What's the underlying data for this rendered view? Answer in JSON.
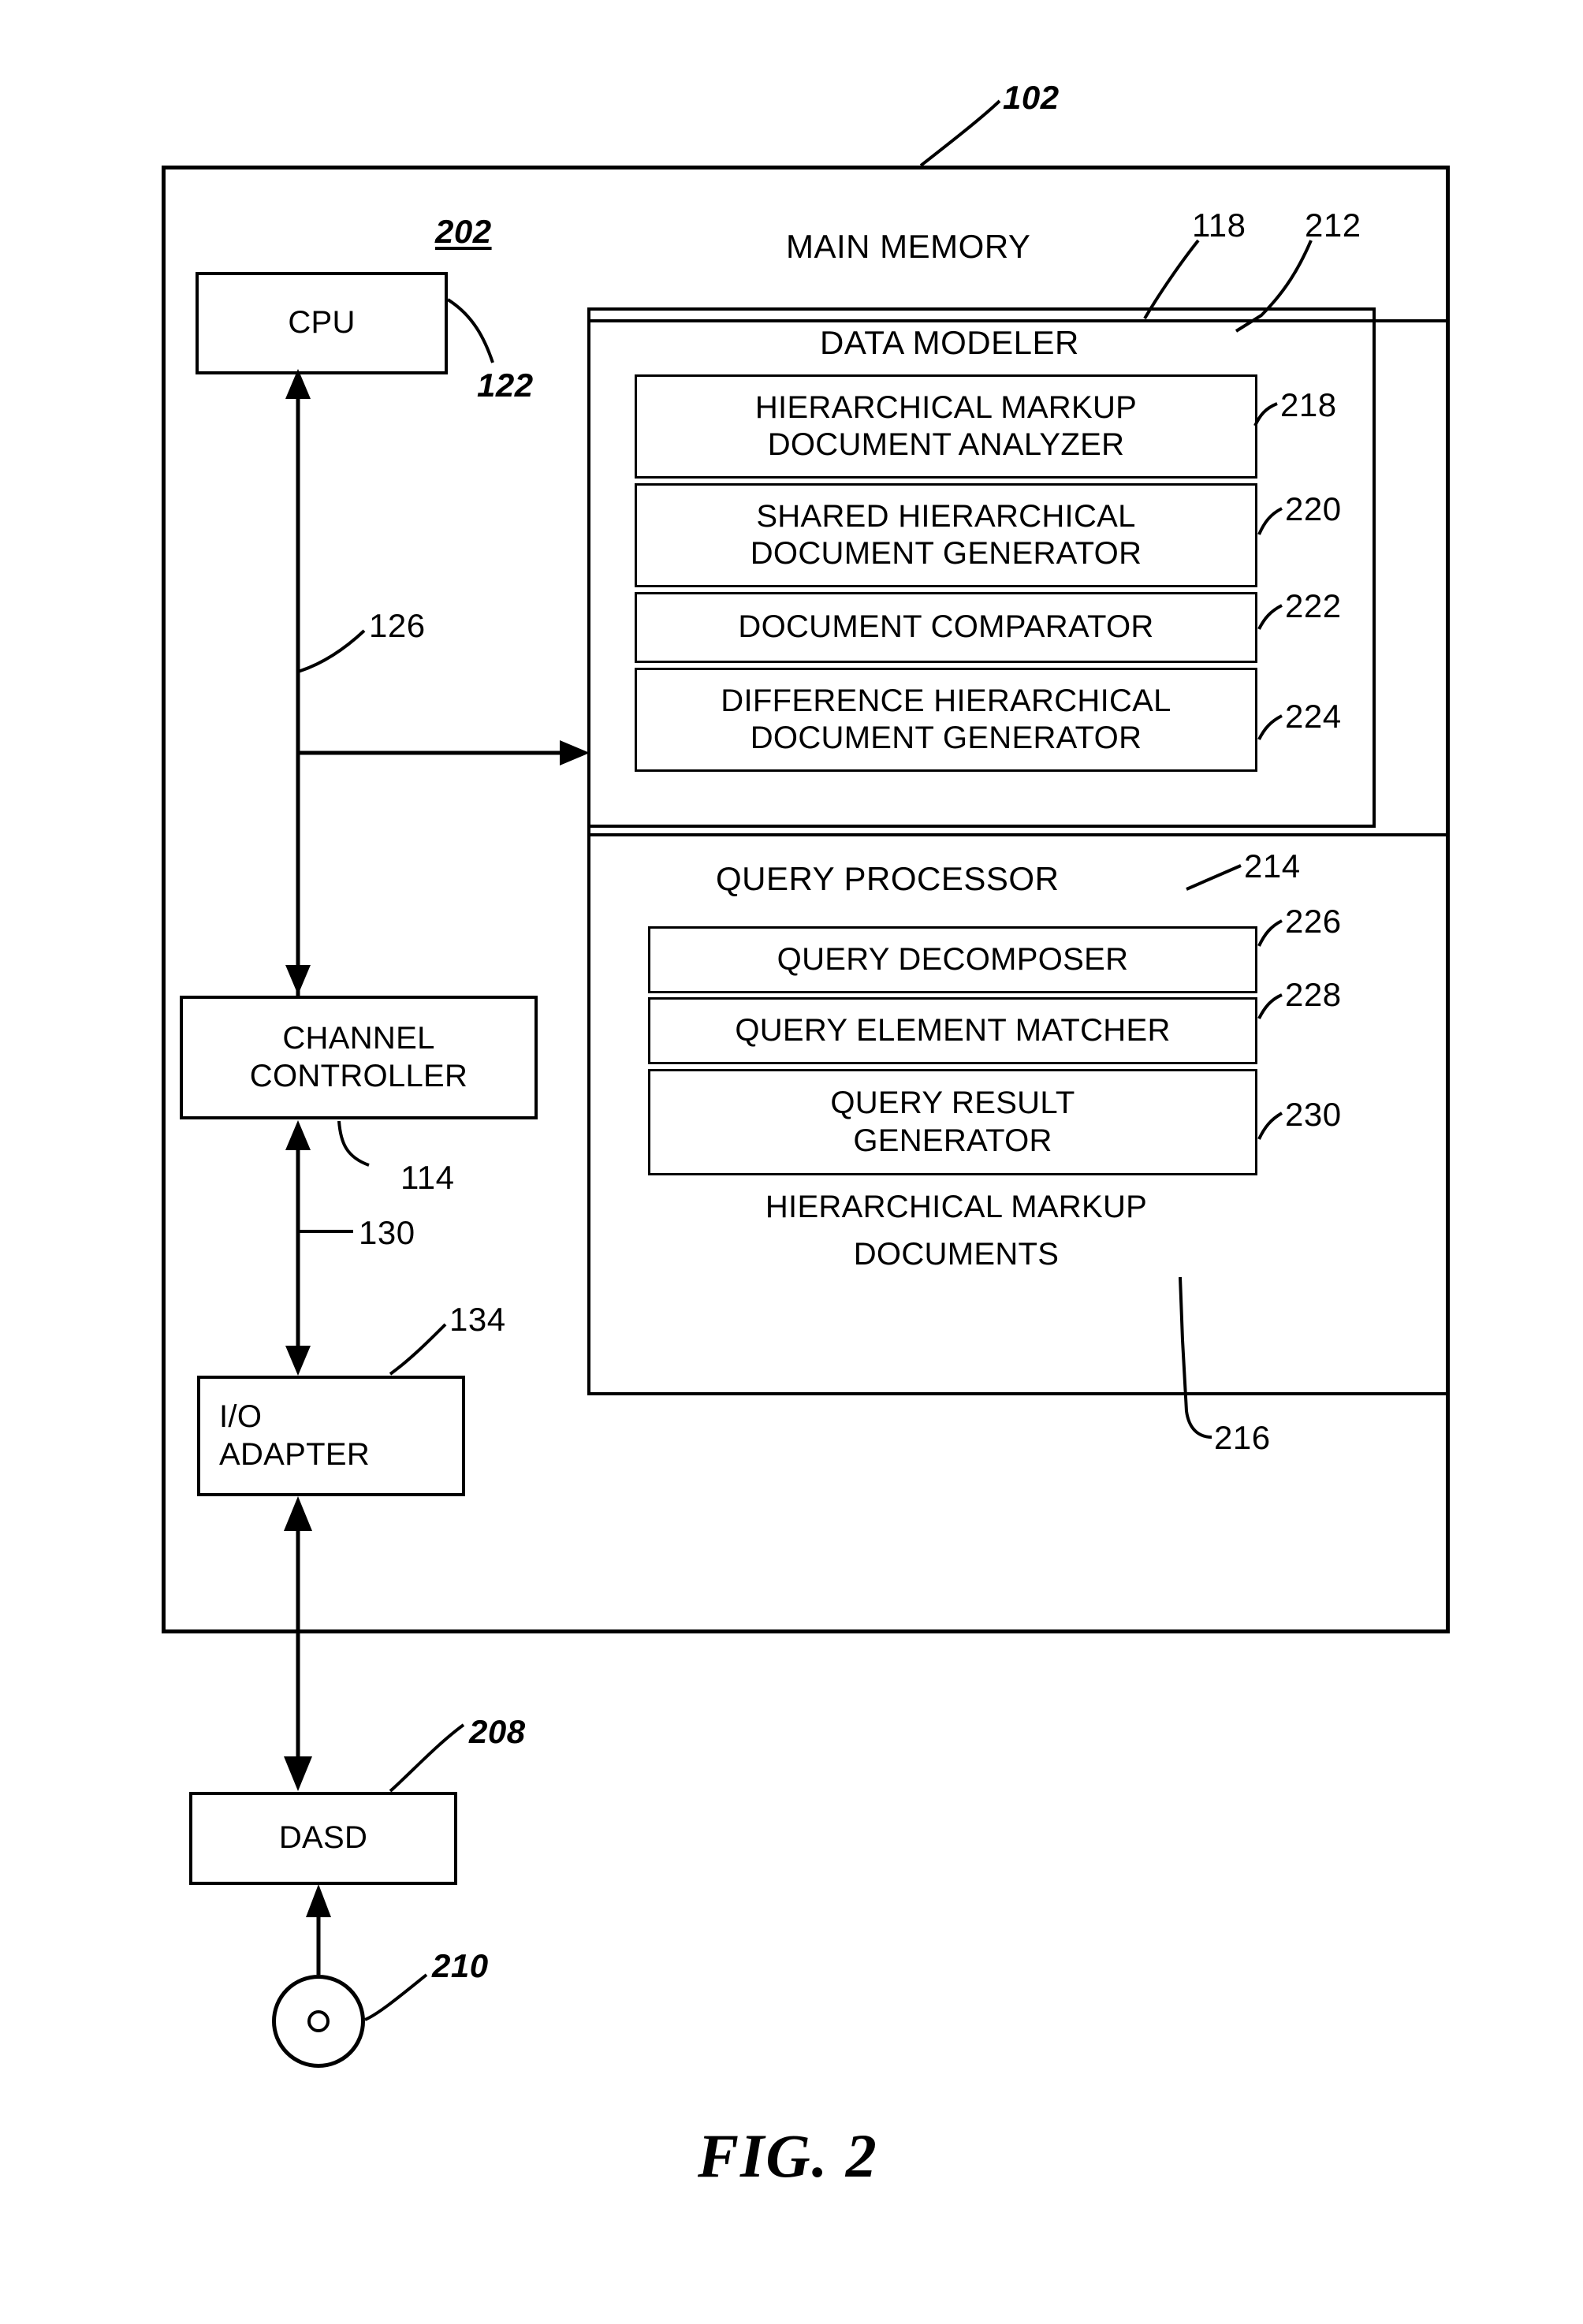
{
  "figure": {
    "caption": "FIG. 2",
    "system_ref": "102"
  },
  "cpu": {
    "label": "CPU",
    "ref_block": "202",
    "ref_leader": "122"
  },
  "bus": {
    "ref": "126"
  },
  "channel_controller": {
    "label_line1": "CHANNEL",
    "label_line2": "CONTROLLER",
    "ref": "114"
  },
  "io_link": {
    "ref": "130"
  },
  "io_adapter": {
    "label_line1": "I/O",
    "label_line2": "ADAPTER",
    "ref": "134"
  },
  "dasd": {
    "label": "DASD",
    "ref": "208"
  },
  "disk_media": {
    "ref": "210",
    "icon": "disk-platter-icon"
  },
  "main_memory": {
    "title": "MAIN MEMORY",
    "ref": "118"
  },
  "data_modeler": {
    "title": "DATA MODELER",
    "ref": "212",
    "components": [
      {
        "label_line1": "HIERARCHICAL MARKUP",
        "label_line2": "DOCUMENT ANALYZER",
        "ref": "218"
      },
      {
        "label_line1": "SHARED HIERARCHICAL",
        "label_line2": "DOCUMENT GENERATOR",
        "ref": "220"
      },
      {
        "label_line1": "DOCUMENT COMPARATOR",
        "label_line2": "",
        "ref": "222"
      },
      {
        "label_line1": "DIFFERENCE HIERARCHICAL",
        "label_line2": "DOCUMENT GENERATOR",
        "ref": "224"
      }
    ]
  },
  "query_processor": {
    "title": "QUERY PROCESSOR",
    "ref": "214",
    "documents_line1": "HIERARCHICAL MARKUP",
    "documents_line2": "DOCUMENTS",
    "documents_ref": "216",
    "components": [
      {
        "label_line1": "QUERY DECOMPOSER",
        "label_line2": "",
        "ref": "226"
      },
      {
        "label_line1": "QUERY ELEMENT MATCHER",
        "label_line2": "",
        "ref": "228"
      },
      {
        "label_line1": "QUERY RESULT",
        "label_line2": "GENERATOR",
        "ref": "230"
      }
    ]
  }
}
